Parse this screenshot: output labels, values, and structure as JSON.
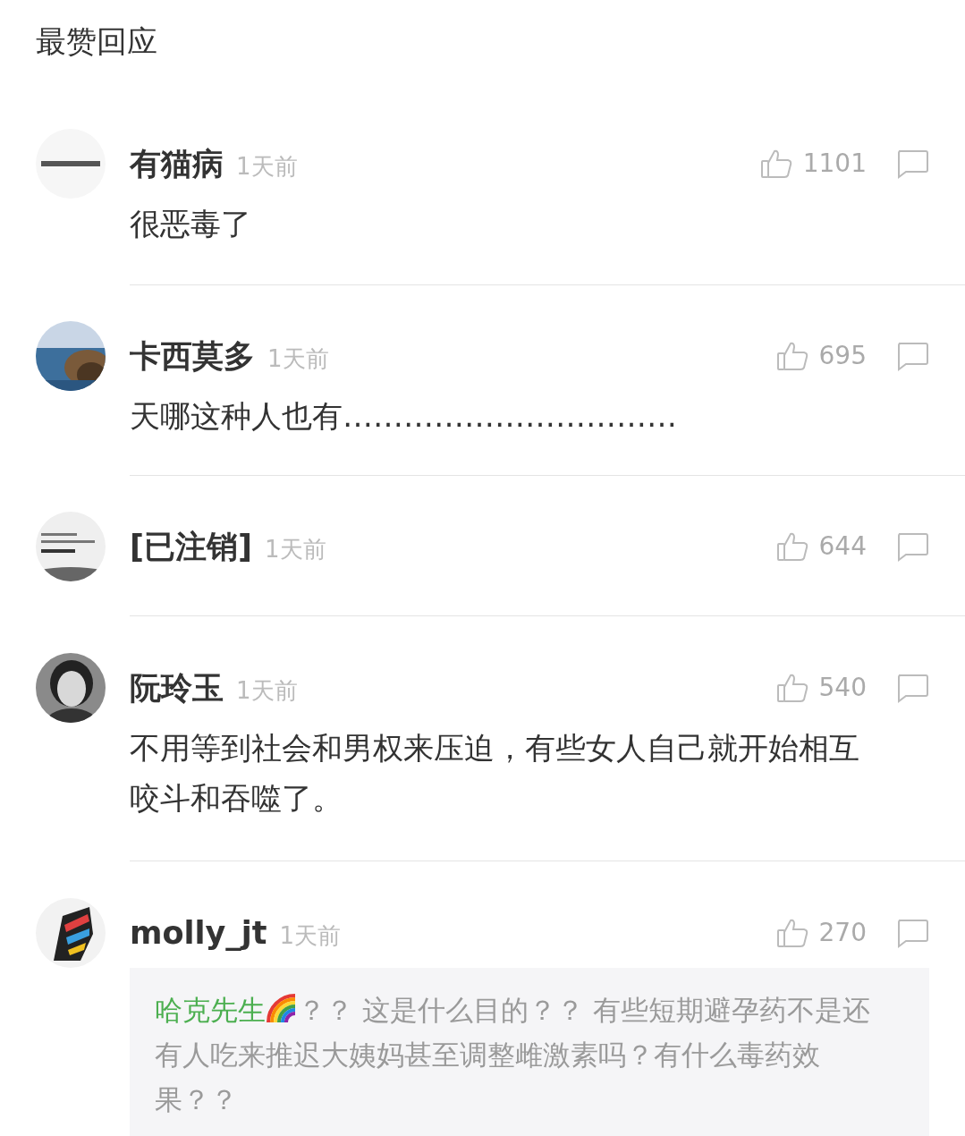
{
  "section_title": "最赞回应",
  "comments": [
    {
      "author": "有猫病",
      "time": "1天前",
      "likes": "1101",
      "text": "很恶毒了"
    },
    {
      "author": "卡西莫多",
      "time": "1天前",
      "likes": "695",
      "text": "天哪这种人也有……………………………"
    },
    {
      "author": "[已注销]",
      "time": "1天前",
      "likes": "644"
    },
    {
      "author": "阮玲玉",
      "time": "1天前",
      "likes": "540",
      "text": "不用等到社会和男权来压迫，有些女人自己就开始相互咬斗和吞噬了。"
    },
    {
      "author": "molly_jt",
      "time": "1天前",
      "likes": "270",
      "quote": {
        "author": "哈克先生",
        "text": "？？ 这是什么目的？？ 有些短期避孕药不是还有人吃来推迟大姨妈甚至调整雌激素吗？有什么毒药效果？？"
      }
    }
  ]
}
